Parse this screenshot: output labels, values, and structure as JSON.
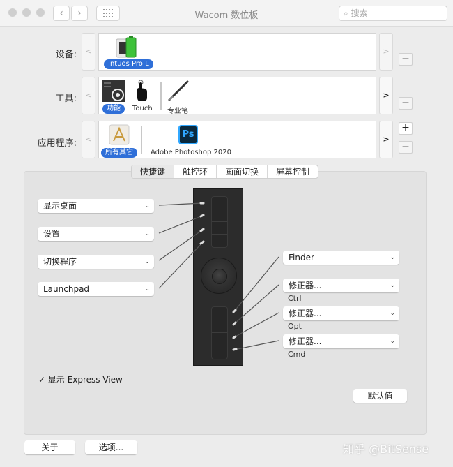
{
  "window": {
    "title": "Wacom 数位板",
    "search_placeholder": "搜索",
    "back_glyph": "‹",
    "forward_glyph": "›",
    "grid_icon": "grid-icon"
  },
  "rows": {
    "device": {
      "label": "设备:",
      "items": [
        {
          "name": "Intuos Pro L",
          "selected": true,
          "icon": "tablet-icon"
        }
      ]
    },
    "tool": {
      "label": "工具:",
      "items": [
        {
          "name": "功能",
          "selected": true,
          "icon": "functions-icon"
        },
        {
          "name": "Touch",
          "selected": false,
          "icon": "touch-icon"
        },
        {
          "name": "专业笔",
          "selected": false,
          "icon": "pen-icon"
        }
      ]
    },
    "app": {
      "label": "应用程序:",
      "items": [
        {
          "name": "所有其它",
          "selected": true,
          "icon": "all-apps-icon"
        },
        {
          "name": "Adobe Photoshop 2020",
          "selected": false,
          "icon": "photoshop-icon",
          "badge": "Ps"
        }
      ]
    },
    "prev": "<",
    "next": ">",
    "plus": "+",
    "minus": "−"
  },
  "tabs": [
    {
      "label": "快捷键",
      "active": true
    },
    {
      "label": "触控环",
      "active": false
    },
    {
      "label": "画面切换",
      "active": false
    },
    {
      "label": "屏幕控制",
      "active": false
    }
  ],
  "left_keys": [
    "显示桌面",
    "设置",
    "切换程序",
    "Launchpad"
  ],
  "right_keys": [
    {
      "value": "Finder",
      "sub": ""
    },
    {
      "value": "修正器...",
      "sub": "Ctrl"
    },
    {
      "value": "修正器...",
      "sub": "Opt"
    },
    {
      "value": "修正器...",
      "sub": "Cmd"
    }
  ],
  "express_view": {
    "label": "显示 Express View",
    "checked": true
  },
  "buttons": {
    "defaults": "默认值",
    "about": "关于",
    "options": "选项..."
  },
  "watermark": "知乎 @BitSense",
  "colors": {
    "accent": "#2f6fd8",
    "device": "#2c2c2c",
    "panel": "#e3e3e3"
  }
}
